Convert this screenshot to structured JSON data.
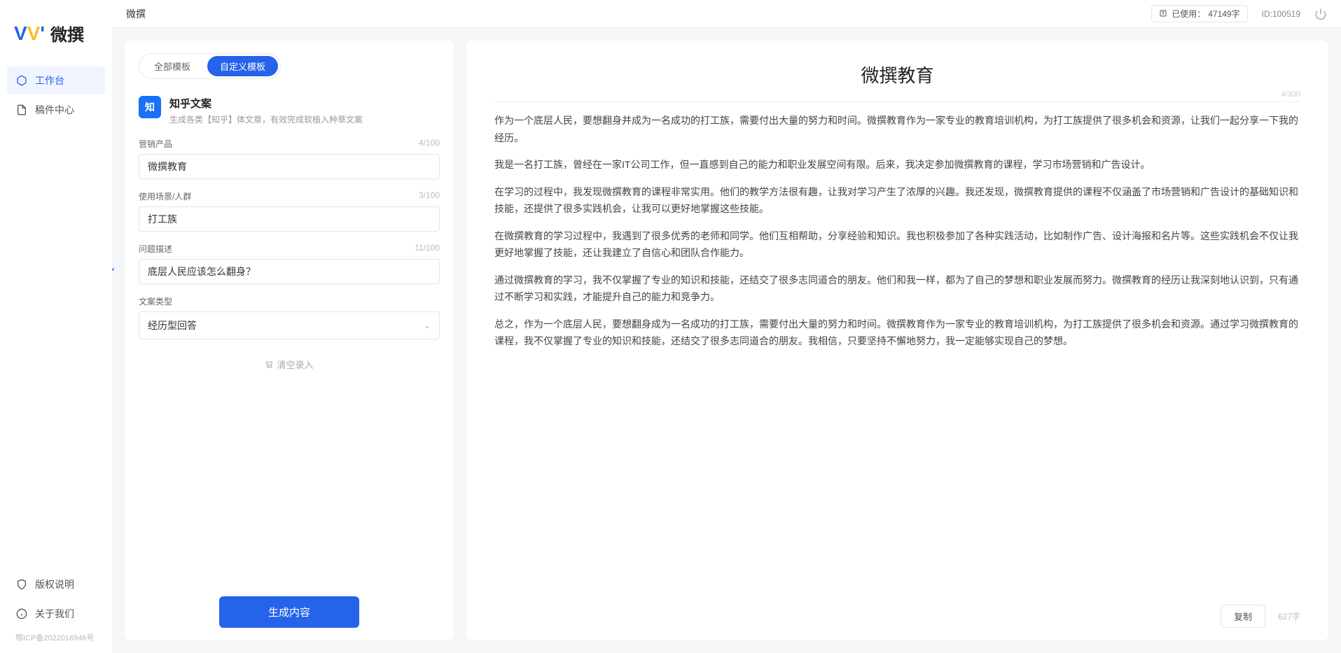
{
  "brand": {
    "name": "微撰"
  },
  "sidebar": {
    "nav": [
      {
        "label": "工作台",
        "icon": "cube-icon",
        "active": true
      },
      {
        "label": "稿件中心",
        "icon": "document-icon",
        "active": false
      }
    ],
    "bottom": [
      {
        "label": "版权说明",
        "icon": "shield-icon"
      },
      {
        "label": "关于我们",
        "icon": "info-icon"
      }
    ],
    "footer": "鄂ICP备2022016946号"
  },
  "topbar": {
    "title": "微撰",
    "usage_label": "已使用：",
    "usage_value": "47149字",
    "id_label": "ID:100519"
  },
  "left_panel": {
    "tabs": [
      {
        "label": "全部模板",
        "active": false
      },
      {
        "label": "自定义模板",
        "active": true
      }
    ],
    "template": {
      "icon_text": "知",
      "title": "知乎文案",
      "desc": "生成各类【知乎】体文章，有效完成软植入种草文案"
    },
    "fields": {
      "product": {
        "label": "营销产品",
        "value": "微撰教育",
        "count": "4/100"
      },
      "scene": {
        "label": "使用场景/人群",
        "value": "打工族",
        "count": "3/100"
      },
      "question": {
        "label": "问题描述",
        "value": "底层人民应该怎么翻身？",
        "count": "11/100"
      },
      "type": {
        "label": "文案类型",
        "value": "经历型回答"
      }
    },
    "clear_label": "清空录入",
    "generate_label": "生成内容"
  },
  "right_panel": {
    "title": "微撰教育",
    "title_counter": "4/300",
    "paragraphs": [
      "作为一个底层人民，要想翻身并成为一名成功的打工族，需要付出大量的努力和时间。微撰教育作为一家专业的教育培训机构，为打工族提供了很多机会和资源，让我们一起分享一下我的经历。",
      "我是一名打工族，曾经在一家IT公司工作，但一直感到自己的能力和职业发展空间有限。后来，我决定参加微撰教育的课程，学习市场营销和广告设计。",
      "在学习的过程中，我发现微撰教育的课程非常实用。他们的教学方法很有趣，让我对学习产生了浓厚的兴趣。我还发现，微撰教育提供的课程不仅涵盖了市场营销和广告设计的基础知识和技能，还提供了很多实践机会，让我可以更好地掌握这些技能。",
      "在微撰教育的学习过程中，我遇到了很多优秀的老师和同学。他们互相帮助，分享经验和知识。我也积极参加了各种实践活动，比如制作广告、设计海报和名片等。这些实践机会不仅让我更好地掌握了技能，还让我建立了自信心和团队合作能力。",
      "通过微撰教育的学习，我不仅掌握了专业的知识和技能，还结交了很多志同道合的朋友。他们和我一样，都为了自己的梦想和职业发展而努力。微撰教育的经历让我深刻地认识到，只有通过不断学习和实践，才能提升自己的能力和竞争力。",
      "总之，作为一个底层人民，要想翻身成为一名成功的打工族，需要付出大量的努力和时间。微撰教育作为一家专业的教育培训机构，为打工族提供了很多机会和资源。通过学习微撰教育的课程，我不仅掌握了专业的知识和技能，还结交了很多志同道合的朋友。我相信，只要坚持不懈地努力，我一定能够实现自己的梦想。"
    ],
    "copy_label": "复制",
    "char_count": "627字"
  }
}
